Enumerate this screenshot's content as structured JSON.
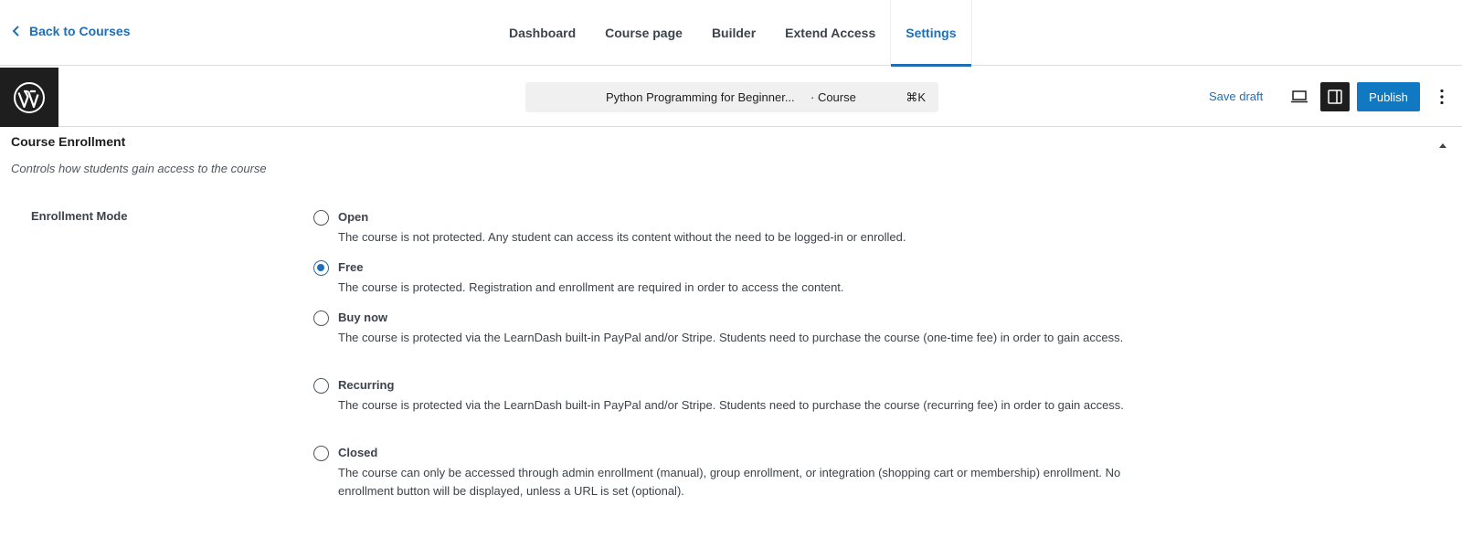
{
  "nav": {
    "back_label": "Back to Courses",
    "tabs": [
      {
        "label": "Dashboard"
      },
      {
        "label": "Course page"
      },
      {
        "label": "Builder"
      },
      {
        "label": "Extend Access"
      },
      {
        "label": "Settings"
      }
    ],
    "active_tab": "Settings"
  },
  "editor": {
    "doc_title": "Python Programming for Beginner...",
    "doc_type": "· Course",
    "shortcut": "⌘K",
    "save_draft": "Save draft",
    "publish": "Publish"
  },
  "section": {
    "title": "Course Enrollment",
    "description": "Controls how students gain access to the course",
    "field_label": "Enrollment Mode",
    "selected": "Free",
    "options": [
      {
        "label": "Open",
        "description": "The course is not protected. Any student can access its content without the need to be logged-in or enrolled."
      },
      {
        "label": "Free",
        "description": "The course is protected. Registration and enrollment are required in order to access the content."
      },
      {
        "label": "Buy now",
        "description": "The course is protected via the LearnDash built-in PayPal and/or Stripe. Students need to purchase the course (one-time fee) in order to gain access."
      },
      {
        "label": "Recurring",
        "description": "The course is protected via the LearnDash built-in PayPal and/or Stripe. Students need to purchase the course (recurring fee) in order to gain access."
      },
      {
        "label": "Closed",
        "description": "The course can only be accessed through admin enrollment (manual), group enrollment, or integration (shopping cart or membership) enrollment. No enrollment button will be displayed, unless a URL is set (optional)."
      }
    ]
  },
  "colors": {
    "accent": "#1e6fb6",
    "publish": "#1079c1",
    "dark": "#1e1e1e"
  },
  "icons": [
    "chevron-left-icon",
    "wordpress-logo",
    "desktop-view-icon",
    "sidebar-toggle-icon",
    "more-vertical-icon",
    "chevron-up-icon"
  ]
}
